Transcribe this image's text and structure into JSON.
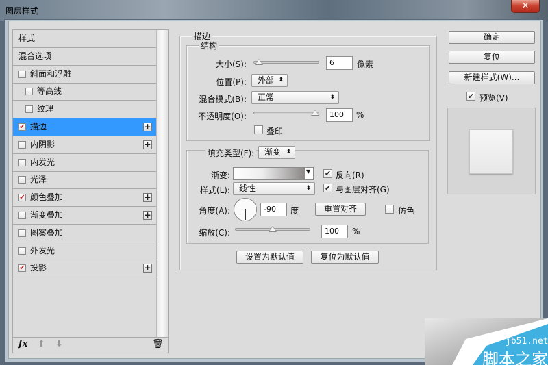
{
  "window": {
    "title": "图层样式",
    "close_icon": "close-icon"
  },
  "sidebar": {
    "items": [
      {
        "label": "样式",
        "has_checkbox": false,
        "checked": false,
        "indent": 0,
        "plus": false,
        "selected": false
      },
      {
        "label": "混合选项",
        "has_checkbox": false,
        "checked": false,
        "indent": 0,
        "plus": false,
        "selected": false
      },
      {
        "label": "斜面和浮雕",
        "has_checkbox": true,
        "checked": false,
        "indent": 0,
        "plus": false,
        "selected": false
      },
      {
        "label": "等高线",
        "has_checkbox": true,
        "checked": false,
        "indent": 1,
        "plus": false,
        "selected": false
      },
      {
        "label": "纹理",
        "has_checkbox": true,
        "checked": false,
        "indent": 1,
        "plus": false,
        "selected": false
      },
      {
        "label": "描边",
        "has_checkbox": true,
        "checked": true,
        "indent": 0,
        "plus": true,
        "selected": true
      },
      {
        "label": "内阴影",
        "has_checkbox": true,
        "checked": false,
        "indent": 0,
        "plus": true,
        "selected": false
      },
      {
        "label": "内发光",
        "has_checkbox": true,
        "checked": false,
        "indent": 0,
        "plus": false,
        "selected": false
      },
      {
        "label": "光泽",
        "has_checkbox": true,
        "checked": false,
        "indent": 0,
        "plus": false,
        "selected": false
      },
      {
        "label": "颜色叠加",
        "has_checkbox": true,
        "checked": true,
        "indent": 0,
        "plus": true,
        "selected": false
      },
      {
        "label": "渐变叠加",
        "has_checkbox": true,
        "checked": false,
        "indent": 0,
        "plus": true,
        "selected": false
      },
      {
        "label": "图案叠加",
        "has_checkbox": true,
        "checked": false,
        "indent": 0,
        "plus": false,
        "selected": false
      },
      {
        "label": "外发光",
        "has_checkbox": true,
        "checked": false,
        "indent": 0,
        "plus": false,
        "selected": false
      },
      {
        "label": "投影",
        "has_checkbox": true,
        "checked": true,
        "indent": 0,
        "plus": true,
        "selected": false
      }
    ],
    "footer": {
      "fx": "fx",
      "up_icon": "arrow-up-icon",
      "down_icon": "arrow-down-icon",
      "trash_icon": "trash-icon"
    },
    "selected_color": "#3399ff"
  },
  "stroke": {
    "title": "描边",
    "structure": {
      "title": "结构",
      "size_label": "大小(S):",
      "size_value": "6",
      "size_unit": "像素",
      "size_slider": 0.02,
      "position_label": "位置(P):",
      "position_value": "外部",
      "blend_label": "混合模式(B):",
      "blend_value": "正常",
      "opacity_label": "不透明度(O):",
      "opacity_value": "100",
      "opacity_unit": "%",
      "opacity_slider": 1.0,
      "overprint_label": "叠印",
      "overprint_checked": false
    },
    "fill": {
      "type_label": "填充类型(F):",
      "type_value": "渐变",
      "gradient_label": "渐变:",
      "reverse_label": "反向(R)",
      "reverse_checked": true,
      "style_label": "样式(L):",
      "style_value": "线性",
      "align_label": "与图层对齐(G)",
      "align_checked": true,
      "angle_label": "角度(A):",
      "angle_value": "-90",
      "angle_unit": "度",
      "reset_align_label": "重置对齐",
      "dither_label": "仿色",
      "dither_checked": false,
      "scale_label": "缩放(C):",
      "scale_value": "100",
      "scale_unit": "%",
      "scale_slider": 0.5
    },
    "set_default_label": "设置为默认值",
    "reset_default_label": "复位为默认值"
  },
  "actions": {
    "ok": "确定",
    "reset": "复位",
    "new_style": "新建样式(W)...",
    "preview_label": "预览(V)",
    "preview_checked": true
  },
  "watermark": {
    "line1": "jb51.net",
    "line2": "脚本之家",
    "color": "#3fb0e0"
  }
}
